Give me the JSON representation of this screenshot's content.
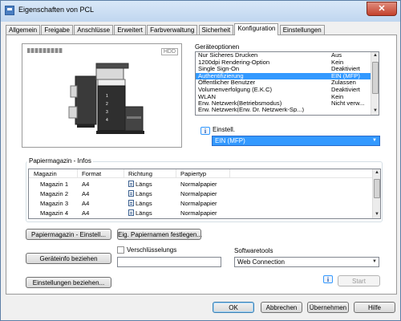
{
  "window": {
    "title": "Eigenschaften von PCL",
    "close_label": "✕"
  },
  "tabs": [
    {
      "label": "Allgemein"
    },
    {
      "label": "Freigabe"
    },
    {
      "label": "Anschlüsse"
    },
    {
      "label": "Erweitert"
    },
    {
      "label": "Farbverwaltung"
    },
    {
      "label": "Sicherheit"
    },
    {
      "label": "Konfiguration",
      "active": true
    },
    {
      "label": "Einstellungen"
    }
  ],
  "preview": {
    "hdd_label": "HDD",
    "tray_numbers": [
      "1",
      "2",
      "3",
      "4"
    ]
  },
  "device_options": {
    "label": "Geräteoptionen",
    "items": [
      {
        "name": "Nur Sicheres Drucken",
        "value": "Aus"
      },
      {
        "name": "1200dpi Rendering-Option",
        "value": "Kein"
      },
      {
        "name": "Single Sign-On",
        "value": "Deaktiviert"
      },
      {
        "name": "Authentifizierung",
        "value": "EIN (MFP)",
        "selected": true
      },
      {
        "name": "Öffentlicher Benutzer",
        "value": "Zulassen"
      },
      {
        "name": "Volumenverfolgung (E.K.C)",
        "value": "Deaktiviert"
      },
      {
        "name": "WLAN",
        "value": "Kein"
      },
      {
        "name": "Erw. Netzwerk(Betriebsmodus)",
        "value": "Nicht verw..."
      }
    ],
    "partial_row": "Erw. Netzwerk(Erw. Dr. Netzwerk-Sp...)"
  },
  "setting": {
    "label": "Einstell.",
    "value": "EIN (MFP)"
  },
  "tray_info": {
    "title": "Papiermagazin - Infos",
    "columns": [
      "Magazin",
      "Format",
      "Richtung",
      "Papiertyp"
    ],
    "rows": [
      {
        "magazin": "Magazin 1",
        "format": "A4",
        "richtung": "Längs",
        "papiertyp": "Normalpapier"
      },
      {
        "magazin": "Magazin 2",
        "format": "A4",
        "richtung": "Längs",
        "papiertyp": "Normalpapier"
      },
      {
        "magazin": "Magazin 3",
        "format": "A4",
        "richtung": "Längs",
        "papiertyp": "Normalpapier"
      },
      {
        "magazin": "Magazin 4",
        "format": "A4",
        "richtung": "Längs",
        "papiertyp": "Normalpapier"
      }
    ]
  },
  "buttons": {
    "tray_settings": "Papiermagazin - Einstell...",
    "paper_names": "Eig. Papiernamen festlegen...",
    "get_device_info": "Geräteinfo beziehen",
    "get_settings": "Einstellungen beziehen...",
    "start": "Start",
    "ok": "OK",
    "cancel": "Abbrechen",
    "apply": "Übernehmen",
    "help": "Hilfe"
  },
  "encryption": {
    "label": "Verschlüsselungs"
  },
  "software_tools": {
    "label": "Softwaretools",
    "value": "Web Connection"
  },
  "colors": {
    "selection": "#3399ff",
    "window_bg": "#f0f0f0",
    "border": "#9a9a9a"
  }
}
